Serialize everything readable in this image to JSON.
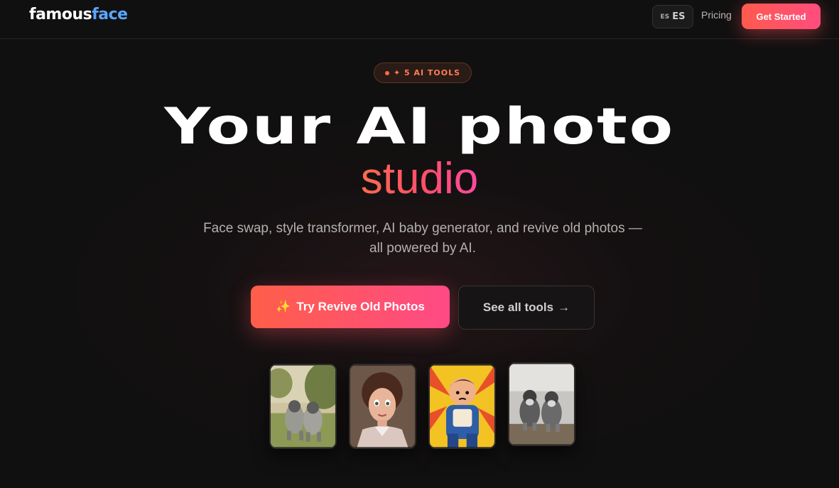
{
  "header": {
    "logo_part1": "famous",
    "logo_part2": "face",
    "lang_flag": "ES",
    "lang_label": "ES",
    "pricing_label": "Pricing",
    "get_started_label": "Get Started"
  },
  "badge": {
    "label": "✦ 5 AI TOOLS"
  },
  "hero": {
    "title_line1": "Your AI photo",
    "title_line2": "studio",
    "subtitle_line1": "Face swap, style transformer, AI baby generator, and revive old photos —",
    "subtitle_line2": "all powered by AI."
  },
  "cta": {
    "primary_icon": "✨",
    "primary_label": "Try Revive Old Photos",
    "secondary_label": "See all tools",
    "secondary_arrow": "→"
  },
  "thumbnails": [
    {
      "name": "dogs-painting",
      "icon": "dogs-painting-image"
    },
    {
      "name": "cartoon-woman",
      "icon": "cartoon-woman-image"
    },
    {
      "name": "comic-baby",
      "icon": "comic-baby-image"
    },
    {
      "name": "dogs-photo",
      "icon": "dogs-photo-image"
    }
  ],
  "colors": {
    "background": "#111010",
    "accent_start": "#ff5e49",
    "accent_end": "#ff4a86",
    "logo_blue": "#5aa6ff"
  }
}
